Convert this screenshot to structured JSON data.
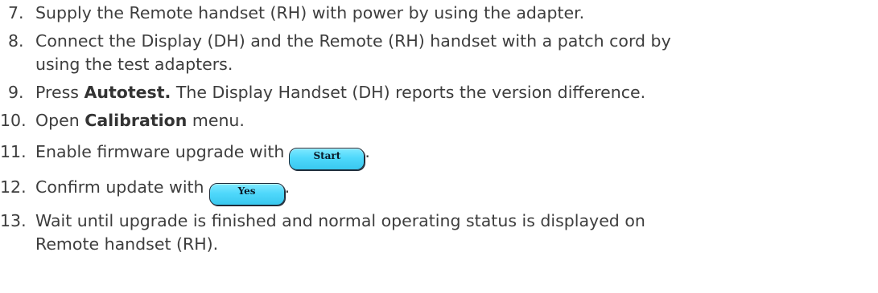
{
  "steps": [
    {
      "number": "7.",
      "text": "Supply the Remote handset (RH) with power by using the adapter."
    },
    {
      "number": "8.",
      "text_line1": "Connect the Display (DH) and the Remote (RH) handset with a patch cord by",
      "text_line2": "using the test adapters."
    },
    {
      "number": "9.",
      "prefix": "Press ",
      "bold": "Autotest.",
      "suffix": " The Display Handset (DH) reports the version difference."
    },
    {
      "number": "10.",
      "prefix": "Open ",
      "bold": "Calibration",
      "suffix": " menu."
    },
    {
      "number": "11.",
      "prefix": "Enable firmware upgrade with",
      "button": "Start",
      "suffix": "."
    },
    {
      "number": "12.",
      "prefix": "Confirm update with",
      "button": "Yes",
      "suffix": "."
    },
    {
      "number": "13.",
      "text_line1": "Wait until upgrade is finished and normal operating status is displayed on",
      "text_line2": "Remote handset (RH)."
    }
  ]
}
